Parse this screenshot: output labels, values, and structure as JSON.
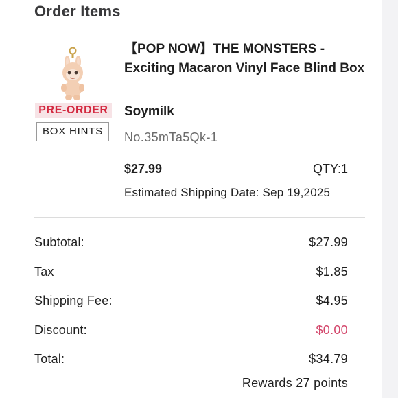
{
  "order_items": {
    "title": "Order Items",
    "product": {
      "name": "【POP NOW】THE MONSTERS - Exciting Macaron Vinyl Face Blind Box",
      "variant": "Soymilk",
      "sku": "No.35mTa5Qk-1",
      "price": "$27.99",
      "qty": "QTY:1",
      "shipping_date": "Estimated Shipping Date: Sep 19,2025",
      "badge": "PRE-ORDER",
      "box_hints_label": "BOX HINTS",
      "image_icon": "plush-keychain-figure-icon"
    }
  },
  "summary": {
    "subtotal_label": "Subtotal:",
    "subtotal_value": "$27.99",
    "tax_label": "Tax",
    "tax_value": "$1.85",
    "shipping_label": "Shipping Fee:",
    "shipping_value": "$4.95",
    "discount_label": "Discount:",
    "discount_value": "$0.00",
    "total_label": "Total:",
    "total_value": "$34.79",
    "rewards": "Rewards 27 points"
  },
  "colors": {
    "preorder_text": "#d3283f",
    "preorder_bg": "#f7e3e6",
    "discount": "#d3456a"
  }
}
